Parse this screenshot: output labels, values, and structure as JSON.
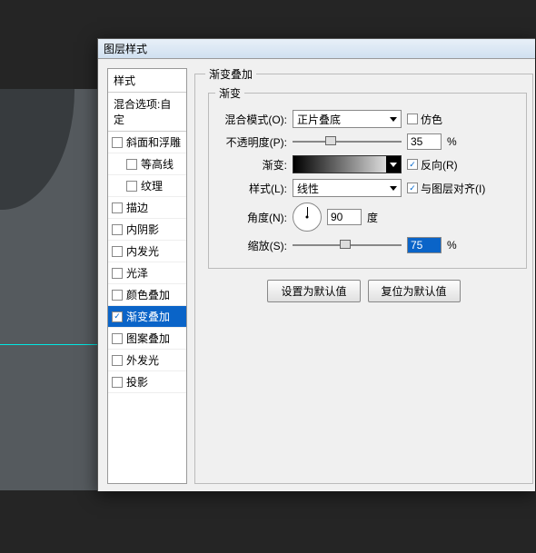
{
  "dialog": {
    "title": "图层样式"
  },
  "styles": {
    "header": "样式",
    "blendOptions": "混合选项:自定",
    "items": [
      {
        "label": "斜面和浮雕",
        "checked": false,
        "indent": false
      },
      {
        "label": "等高线",
        "checked": false,
        "indent": true
      },
      {
        "label": "纹理",
        "checked": false,
        "indent": true
      },
      {
        "label": "描边",
        "checked": false,
        "indent": false
      },
      {
        "label": "内阴影",
        "checked": false,
        "indent": false
      },
      {
        "label": "内发光",
        "checked": false,
        "indent": false
      },
      {
        "label": "光泽",
        "checked": false,
        "indent": false
      },
      {
        "label": "颜色叠加",
        "checked": false,
        "indent": false
      },
      {
        "label": "渐变叠加",
        "checked": true,
        "indent": false,
        "selected": true
      },
      {
        "label": "图案叠加",
        "checked": false,
        "indent": false
      },
      {
        "label": "外发光",
        "checked": false,
        "indent": false
      },
      {
        "label": "投影",
        "checked": false,
        "indent": false
      }
    ]
  },
  "panel": {
    "groupTitle": "渐变叠加",
    "subGroupTitle": "渐变",
    "blendModeLabel": "混合模式(O):",
    "blendModeValue": "正片叠底",
    "ditherLabel": "仿色",
    "opacityLabel": "不透明度(P):",
    "opacityValue": "35",
    "percent": "%",
    "gradientLabel": "渐变:",
    "reverseLabel": "反向(R)",
    "styleLabel": "样式(L):",
    "styleValue": "线性",
    "alignLabel": "与图层对齐(I)",
    "angleLabel": "角度(N):",
    "angleValue": "90",
    "degree": "度",
    "scaleLabel": "缩放(S):",
    "scaleValue": "75",
    "setDefault": "设置为默认值",
    "resetDefault": "复位为默认值"
  }
}
